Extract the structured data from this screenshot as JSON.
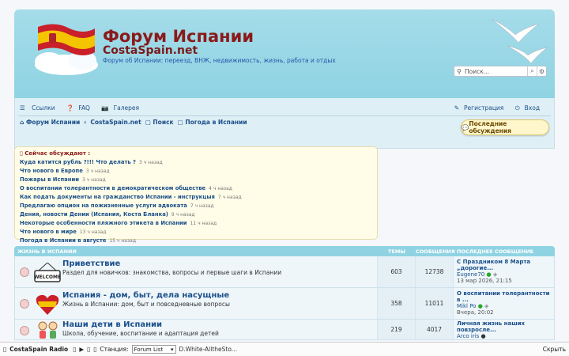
{
  "header": {
    "title": "Форум Испании",
    "subtitle": "CostaSpain.net",
    "description": "Форум об Испании: переезд, ВНЖ, недвижимость, жизнь, работа и отдых",
    "search_placeholder": "Поиск…",
    "search_icon": "search-icon",
    "advanced_icon": "gear-icon"
  },
  "nav": {
    "links_label": "Ссылки",
    "faq_label": "FAQ",
    "gallery_label": "Галерея",
    "register_label": "Регистрация",
    "login_label": "Вход"
  },
  "breadcrumbs": [
    "Форум Испании",
    "CostaSpain.net",
    "Поиск",
    "Погода в Испании"
  ],
  "latest_button": "Последние обсуждения",
  "now_discussed": {
    "title": "Сейчас обсуждают :",
    "items": [
      {
        "title": "Куда катится рубль ?!!! Что делать ?",
        "ago": "3 ч назад"
      },
      {
        "title": "Что нового в Европе",
        "ago": "3 ч назад"
      },
      {
        "title": "Пожары в Испании",
        "ago": "3 ч назад"
      },
      {
        "title": "О воспитании толерантности в демократическом обществе",
        "ago": "4 ч назад"
      },
      {
        "title": "Как подать документы на гражданство Испании - инструкцыя",
        "ago": "7 ч назад"
      },
      {
        "title": "Предлагаю опцион на пожизненные услуги адвоката",
        "ago": "7 ч назад"
      },
      {
        "title": "Дения, новости Дении (Испания, Коста Бланка)",
        "ago": "9 ч назад"
      },
      {
        "title": "Некоторые особенности пляжного этикета в Испании",
        "ago": "11 ч назад"
      },
      {
        "title": "Что нового в мире",
        "ago": "13 ч назад"
      },
      {
        "title": "Погода в Испании в августе",
        "ago": "15 ч назад"
      }
    ]
  },
  "forum_section": {
    "name": "ЖИЗНЬ В ИСПАНИИ",
    "col_topics": "ТЕМЫ",
    "col_posts": "СООБЩЕНИЯ",
    "col_last": "ПОСЛЕДНЕЕ СООБЩЕНИЕ",
    "rows": [
      {
        "title": "Приветствие",
        "desc": "Раздел для новичков: знакомства, вопросы и первые шаги в Испании",
        "topics": "603",
        "posts": "12738",
        "last_title": "С Праздником 8 Марта „дорогие...",
        "last_user": "Eugene70",
        "last_date": "13 мар 2026, 21:15"
      },
      {
        "title": "Испания - дом, быт, дела насущные",
        "desc": "Жизнь в Испании: дом, быт и повседневные вопросы",
        "topics": "358",
        "posts": "11011",
        "last_title": "О воспитании толерантности в ...",
        "last_user": "Mikl Po",
        "last_date": "Вчера, 20:02"
      },
      {
        "title": "Наши дети в Испании",
        "desc": "Школа, обучение, воспитание и адаптация детей",
        "topics": "219",
        "posts": "4017",
        "last_title": "Личная жизнь наших повзросле...",
        "last_user": "Arco iris",
        "last_date": ""
      }
    ]
  },
  "radio": {
    "name": "CostaSpain Radio",
    "station_label": "Станция:",
    "station_value": "Forum List",
    "track": "D.White-AlltheSto...",
    "hide_label": "Скрыть"
  }
}
